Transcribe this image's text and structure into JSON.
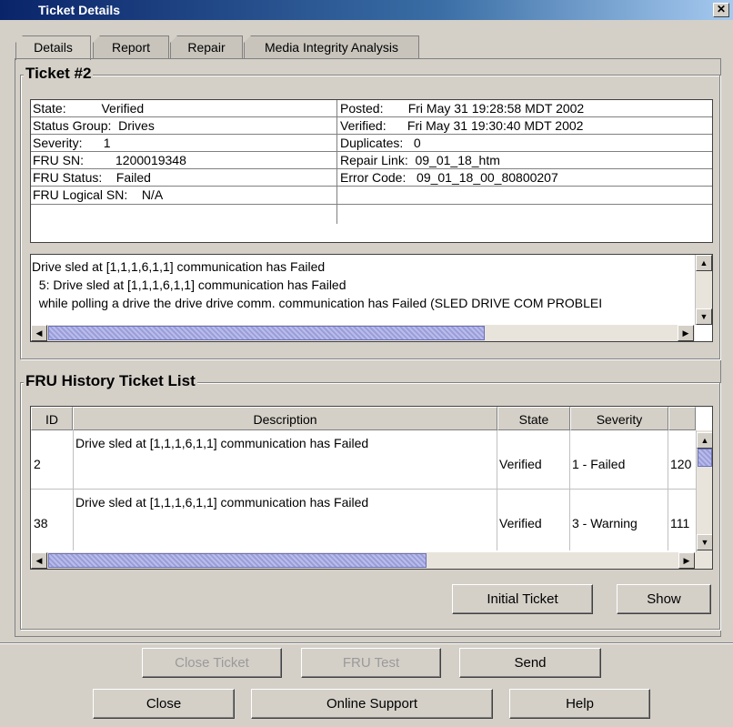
{
  "window": {
    "title": "Ticket Details",
    "close_glyph": "✕"
  },
  "tabs": [
    {
      "label": "Details",
      "active": true
    },
    {
      "label": "Report",
      "active": false
    },
    {
      "label": "Repair",
      "active": false
    },
    {
      "label": "Media Integrity Analysis",
      "active": false
    }
  ],
  "ticket": {
    "heading": "Ticket #2",
    "left": [
      "State:          Verified",
      "Status Group:  Drives",
      "Severity:      1",
      "FRU SN:         1200019348",
      "FRU Status:    Failed",
      "FRU Logical SN:    N/A"
    ],
    "right": [
      "Posted:       Fri May 31 19:28:58 MDT 2002",
      "Verified:      Fri May 31 19:30:40 MDT 2002",
      "Duplicates:   0",
      "Repair Link:  09_01_18_htm",
      "Error Code:   09_01_18_00_80800207",
      ""
    ],
    "message_lines": [
      "Drive sled at [1,1,1,6,1,1] communication has Failed",
      "  5: Drive sled at [1,1,1,6,1,1] communication has Failed",
      "  while polling a drive the drive drive comm. communication has Failed (SLED DRIVE COM PROBLEI"
    ]
  },
  "history": {
    "heading": "FRU History Ticket List",
    "columns": [
      "ID",
      "Description",
      "State",
      "Severity",
      ""
    ],
    "rows": [
      {
        "id": "2",
        "description": "Drive sled at [1,1,1,6,1,1] communication has Failed",
        "state": "Verified",
        "severity": "1 - Failed",
        "sn": "120"
      },
      {
        "id": "38",
        "description": "Drive sled at [1,1,1,6,1,1] communication has Failed",
        "state": "Verified",
        "severity": "3 - Warning",
        "sn": "111"
      }
    ],
    "initial_ticket_label": "Initial Ticket",
    "show_label": "Show"
  },
  "actions": {
    "close_ticket": "Close Ticket",
    "fru_test": "FRU Test",
    "send": "Send",
    "close": "Close",
    "online_support": "Online Support",
    "help": "Help"
  },
  "colors": {
    "title_start": "#0a246a",
    "title_end": "#a6caf0",
    "scroll_thumb": "#9a9ed8"
  },
  "icons": {
    "up": "▲",
    "down": "▼",
    "left": "◀",
    "right": "▶"
  }
}
